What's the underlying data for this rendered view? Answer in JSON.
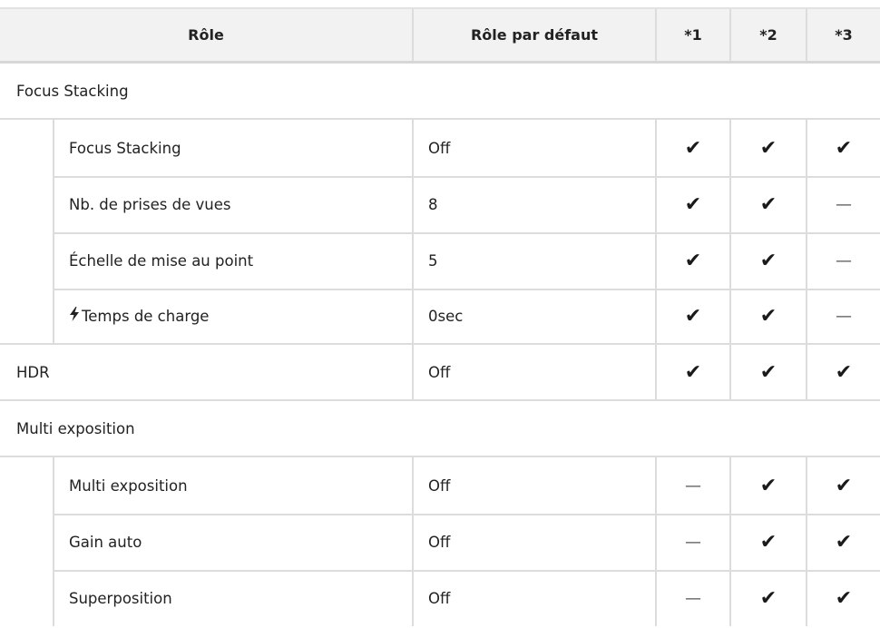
{
  "header": {
    "role": "Rôle",
    "default": "Rôle par défaut",
    "c1": "*1",
    "c2": "*2",
    "c3": "*3"
  },
  "groups": [
    {
      "label": "Focus Stacking",
      "rows": [
        {
          "role": "Focus Stacking",
          "default": "Off",
          "c1": "✔",
          "c2": "✔",
          "c3": "✔"
        },
        {
          "role": "Nb. de prises de vues",
          "default": "8",
          "c1": "✔",
          "c2": "✔",
          "c3": "—"
        },
        {
          "role": "Échelle de mise au point",
          "default": "5",
          "c1": "✔",
          "c2": "✔",
          "c3": "—"
        },
        {
          "icon": "flash-icon",
          "role": "Temps de charge",
          "default": "0sec",
          "c1": "✔",
          "c2": "✔",
          "c3": "—"
        }
      ]
    },
    {
      "label": "HDR",
      "single": {
        "default": "Off",
        "c1": "✔",
        "c2": "✔",
        "c3": "✔"
      }
    },
    {
      "label": "Multi exposition",
      "rows": [
        {
          "role": "Multi exposition",
          "default": "Off",
          "c1": "—",
          "c2": "✔",
          "c3": "✔"
        },
        {
          "role": "Gain auto",
          "default": "Off",
          "c1": "—",
          "c2": "✔",
          "c3": "✔"
        },
        {
          "role": "Superposition",
          "default": "Off",
          "c1": "—",
          "c2": "✔",
          "c3": "✔"
        }
      ]
    }
  ]
}
